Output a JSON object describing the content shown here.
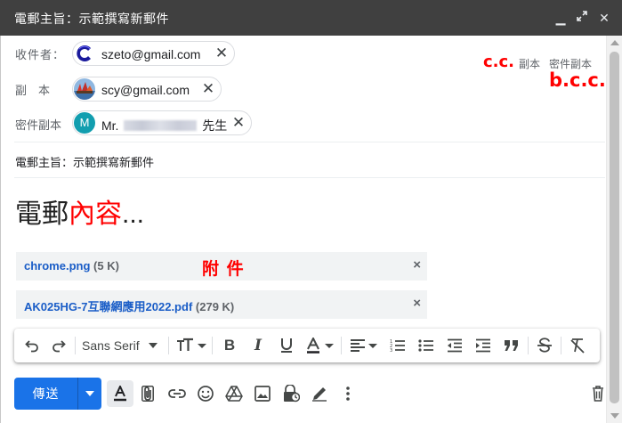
{
  "window": {
    "title": "電郵主旨：示範撰寫新郵件",
    "minimize_glyph": "▁",
    "expand_glyph": "⤢",
    "close_glyph": "✕"
  },
  "recipients": {
    "to_label": "收件者：",
    "cc_label": "副　本",
    "bcc_label": "密件副本",
    "to": [
      {
        "address": "szeto@gmail.com",
        "avatar_icon": "c-logo-avatar"
      }
    ],
    "cc": [
      {
        "address": "scy@gmail.com",
        "avatar_icon": "photo-avatar"
      }
    ],
    "bcc": [
      {
        "name": "Mr.",
        "suffix": "先生",
        "avatar_initial": "M",
        "avatar_color": "#129eaf"
      }
    ],
    "remove_glyph": "✕"
  },
  "header_links": {
    "cc": "副本",
    "bcc": "密件副本"
  },
  "annotations": {
    "cc": "c.c.",
    "bcc": "b.c.c.",
    "attachments": "附 件",
    "color": "#ff0000"
  },
  "subject": "電郵主旨：示範撰寫新郵件",
  "body": {
    "part1": "電郵",
    "part2": "內容",
    "part3": "..."
  },
  "attachments": [
    {
      "name": "chrome.png",
      "size": "(5 K)"
    },
    {
      "name": "AK025HG-7互聯網應用2022.pdf",
      "size": "(279 K)"
    }
  ],
  "attachment_remove_glyph": "×",
  "formatting": {
    "font_family": "Sans Serif",
    "tools": [
      "undo-icon",
      "redo-icon",
      "font-family-select",
      "font-size-icon",
      "bold-icon",
      "italic-icon",
      "underline-icon",
      "text-color-icon",
      "align-icon",
      "numbered-list-icon",
      "bulleted-list-icon",
      "indent-less-icon",
      "indent-more-icon",
      "quote-icon",
      "strikethrough-icon",
      "remove-formatting-icon"
    ]
  },
  "actions": {
    "send": "傳送",
    "icons": [
      "formatting-options-icon",
      "attach-file-icon",
      "insert-link-icon",
      "emoji-icon",
      "google-drive-icon",
      "insert-photo-icon",
      "confidential-mode-icon",
      "signature-icon",
      "more-options-icon",
      "discard-draft-icon"
    ]
  },
  "colors": {
    "titlebar": "#404040",
    "accent": "#1a73e8",
    "link": "#1a5dc7",
    "annotation": "#ff0000"
  }
}
